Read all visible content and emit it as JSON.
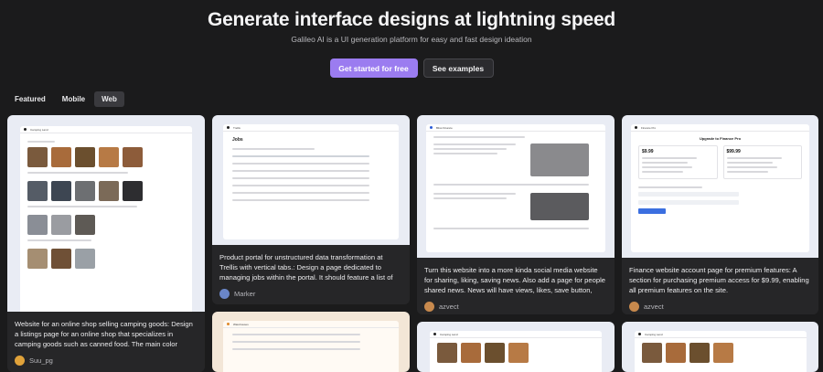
{
  "hero": {
    "title": "Generate interface designs at lightning speed",
    "subtitle": "Galileo AI is a UI generation platform for easy and fast design ideation"
  },
  "cta": {
    "primary": "Get started for free",
    "secondary": "See examples"
  },
  "tabs": [
    {
      "label": "Featured",
      "active": false
    },
    {
      "label": "Mobile",
      "active": false
    },
    {
      "label": "Web",
      "active": true
    }
  ],
  "cards": [
    {
      "description": "Website for an online shop selling camping goods: Design a listings page for an online shop that specializes in camping goods such as canned food. The main color theme should be...",
      "author": "Suu_pg",
      "avatar_color": "#e0a23a"
    },
    {
      "description": "Product portal for unstructured data transformation at Trellis with vertical tabs.: Design a page dedicated to managing jobs within the portal. It should feature a list of running jobs with...",
      "author": "Marker",
      "avatar_color": "#6a86c9"
    },
    {
      "description": "Turn this website into a more kinda social media website for sharing, liking, saving news. Also add a page for people shared news. News will have views, likes, save button, sharing,...",
      "author": "azvect",
      "avatar_color": "#c7894d"
    },
    {
      "description": "Finance website account page for premium features: A section for purchasing premium access for $9.99, enabling all premium features on the site.",
      "author": "azvect",
      "avatar_color": "#c7894d"
    }
  ],
  "mini": {
    "camping_logo": "Camping Land",
    "trellis_logo": "Trellis",
    "trellis_heading": "Jobs",
    "news_logo": "Bliss Finance",
    "finance_logo": "Finance Pro",
    "finance_heading": "Upgrade to Finance Pro",
    "price_monthly": "$9.99",
    "price_yearly": "$99.99",
    "warehouse_logo": "Warehouses"
  }
}
